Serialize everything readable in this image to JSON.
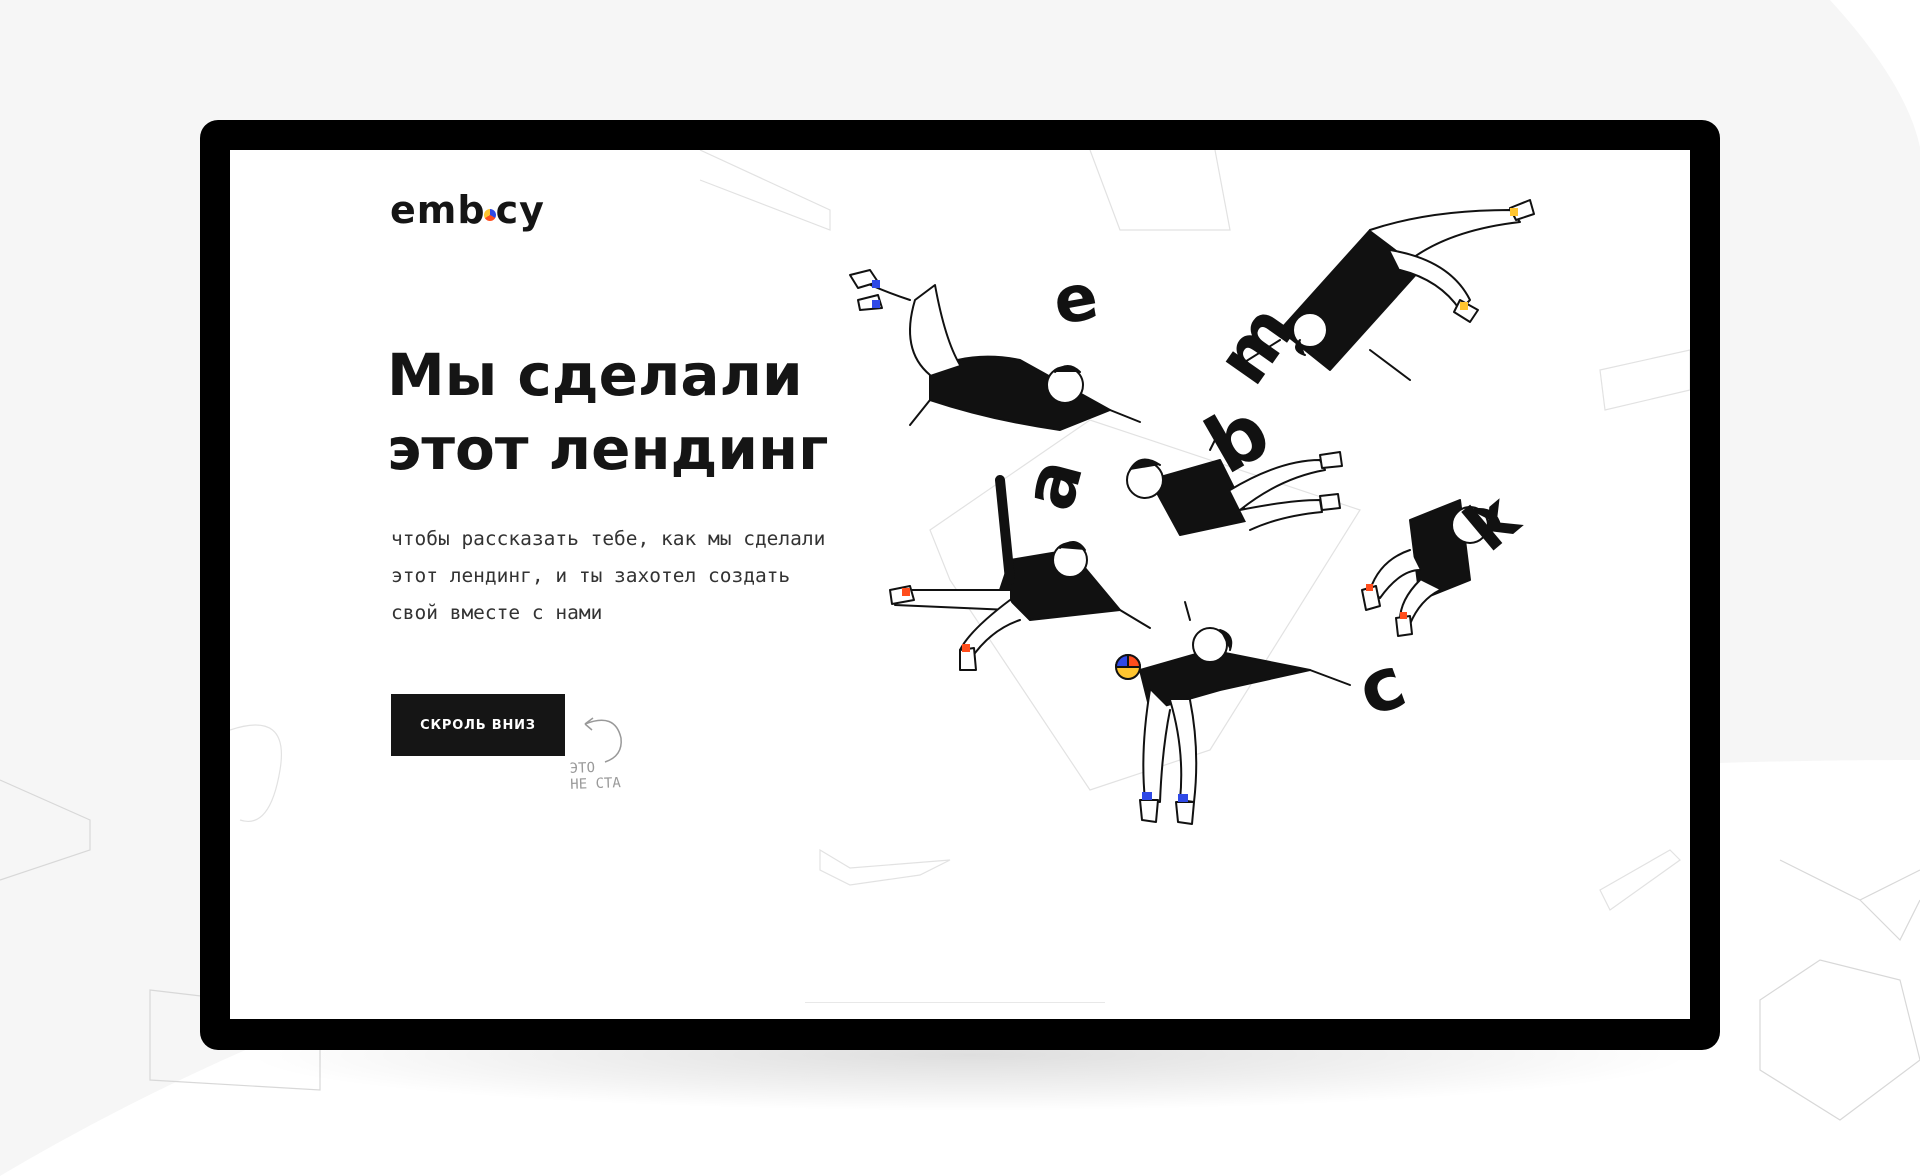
{
  "brand": {
    "logo_text": "emb",
    "logo_text_end": "cy"
  },
  "hero": {
    "headline_line1": "Мы сделали",
    "headline_line2": "этот лендинг",
    "subtext_line1": "чтобы рассказать тебе, как мы сделали",
    "subtext_line2": "этот лендинг, и ты захотел создать",
    "subtext_line3": "свой вместе с нами",
    "cta_label": "СКРОЛЬ ВНИЗ",
    "hint_line1": "ЭТО",
    "hint_line2": "НЕ СТА"
  },
  "illustration": {
    "letters": [
      "e",
      "m",
      "a",
      "b",
      "k",
      "c"
    ]
  },
  "colors": {
    "accent_blue": "#2f49e6",
    "accent_orange": "#ff4d1c",
    "accent_yellow": "#ffc530",
    "ink": "#151515",
    "monitor": "#000000"
  }
}
